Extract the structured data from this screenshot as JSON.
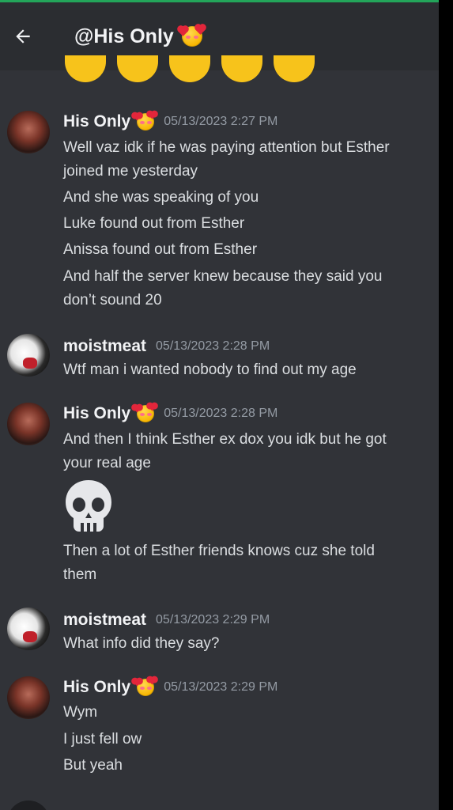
{
  "header": {
    "title": "@His Only",
    "back_icon": "arrow-left-icon",
    "emoji_icon": "smiling-face-with-hearts"
  },
  "colors": {
    "background": "#313338",
    "header": "#2b2d31",
    "text": "#dbdee1",
    "timestamp": "#949ba4",
    "online": "#23a55a"
  },
  "messages": [
    {
      "author": "His Only",
      "timestamp": "05/13/2023 2:27 PM",
      "has_emoji": true,
      "lines": [
        "Well vaz idk if he was paying attention but Esther",
        "joined me yesterday",
        "And she was speaking of you",
        "Luke found out from Esther",
        "Anissa found out from Esther",
        "And half the server knew because they said you",
        "don’t sound 20"
      ]
    },
    {
      "author": "moistmeat",
      "timestamp": "05/13/2023 2:28 PM",
      "has_emoji": false,
      "lines": [
        "Wtf man i wanted nobody to find out my age"
      ]
    },
    {
      "author": "His Only",
      "timestamp": "05/13/2023 2:28 PM",
      "has_emoji": true,
      "lines": [
        "And then I think Esther ex dox you idk but he got",
        "your real age",
        "Then a lot of Esther friends knows cuz she told",
        "them"
      ],
      "skull_emoji": "skull"
    },
    {
      "author": "moistmeat",
      "timestamp": "05/13/2023 2:29 PM",
      "has_emoji": false,
      "lines": [
        "What info did they say?"
      ]
    },
    {
      "author": "His Only",
      "timestamp": "05/13/2023 2:29 PM",
      "has_emoji": true,
      "lines": [
        "Wym",
        "I just fell ow",
        "But yeah"
      ]
    }
  ]
}
